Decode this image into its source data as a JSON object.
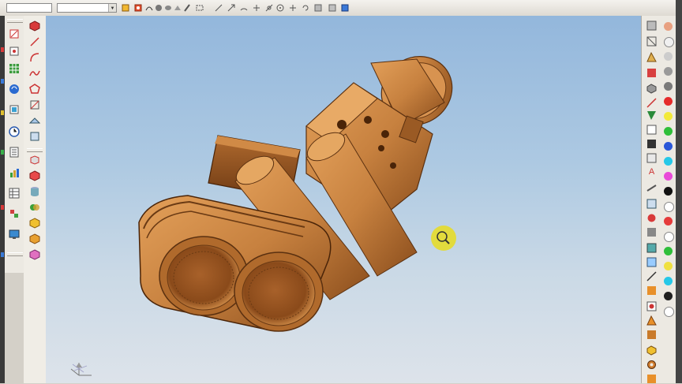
{
  "toolbar": {
    "combo_left": "",
    "combo_right": ""
  },
  "viewport": {
    "model": "binocular-housing-part",
    "model_color": "#c7813f",
    "cursor": "zoom-cursor"
  },
  "colors": {
    "viewport_top": "#93b7dc",
    "viewport_bottom": "#dde3ea",
    "cursor_highlight": "#e5dc2a"
  },
  "color_palette": [
    "#e8a080",
    "#f0f0f0",
    "#cccccc",
    "#9a9a9a",
    "#7a7a7a",
    "#e52b2b",
    "#f2e93a",
    "#2fbf3a",
    "#2a57d8",
    "#25c8e8",
    "#e94ad8",
    "#111111",
    "#ffffff",
    "#e53b3b",
    "#ffffff",
    "#2fbf3a",
    "#f0e040",
    "#25c8e8",
    "#202020",
    "#ffffff"
  ]
}
